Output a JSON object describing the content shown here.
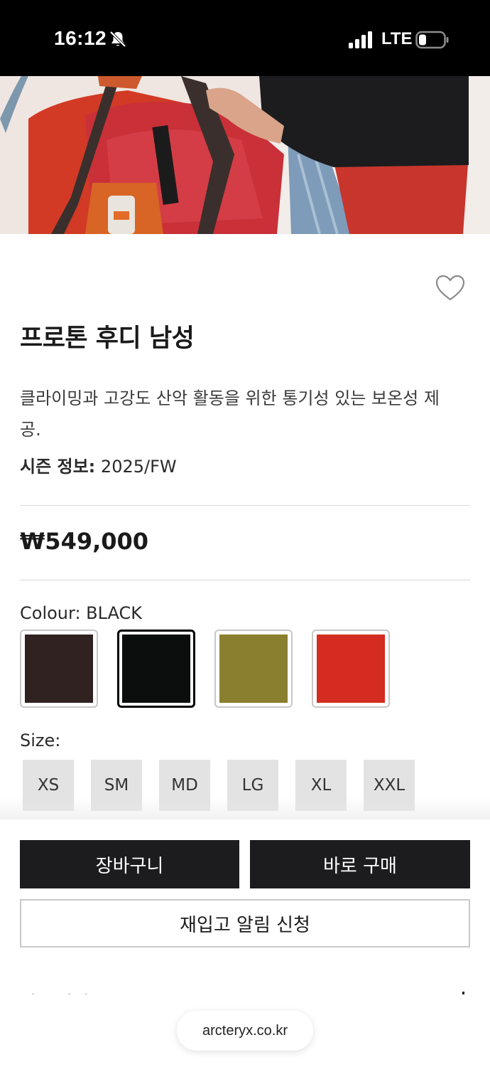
{
  "status_bar": {
    "time": "16:12",
    "network": "LTE"
  },
  "product": {
    "title": "프로톤 후디 남성",
    "description": "클라이밍과 고강도 산악 활동을 위한 통기성 있는 보온성 제공.",
    "season_label": "시즌 정보:",
    "season_value": "2025/FW",
    "price": "₩549,000"
  },
  "colour": {
    "label": "Colour: BLACK",
    "swatches": [
      {
        "name": "dark-brown",
        "hex": "#2f2221",
        "selected": false
      },
      {
        "name": "black",
        "hex": "#0c0e0d",
        "selected": true
      },
      {
        "name": "olive",
        "hex": "#8a7f2e",
        "selected": false
      },
      {
        "name": "red",
        "hex": "#d42c21",
        "selected": false
      }
    ]
  },
  "size": {
    "label": "Size:",
    "options": [
      "XS",
      "SM",
      "MD",
      "LG",
      "XL",
      "XXL"
    ]
  },
  "actions": {
    "cart": "장바구니",
    "buy_now": "바로 구매",
    "restock_alert": "재입고 알림 신청"
  },
  "section_peek": "제품 상세",
  "browser": {
    "url": "arcteryx.co.kr"
  },
  "icons": {
    "wishlist": "heart-outline-icon",
    "mute": "bell-slash-icon",
    "signal": "cellular-signal-icon",
    "battery": "battery-low-icon"
  },
  "colors": {
    "button_dark": "#1c1c1e",
    "size_chip": "#e3e3e3"
  }
}
